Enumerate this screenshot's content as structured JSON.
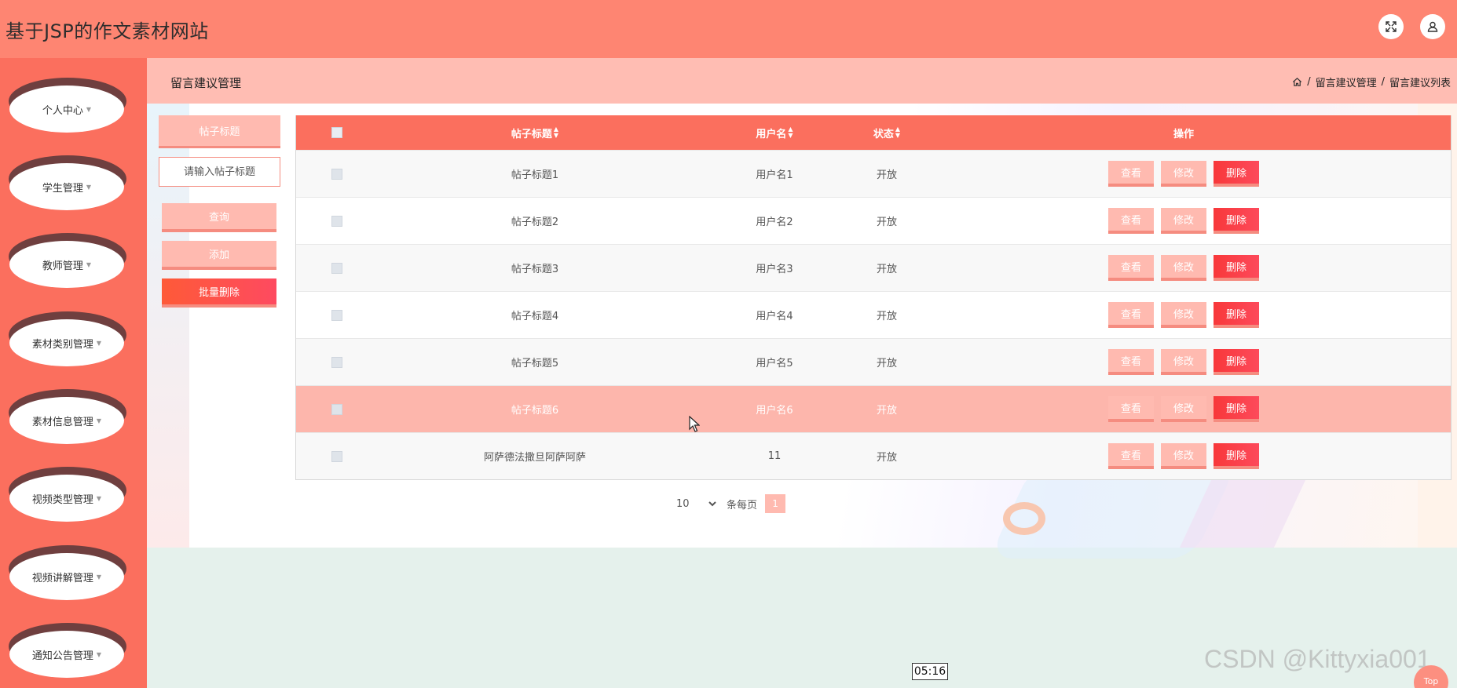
{
  "header": {
    "site_title": "基于JSP的作文素材网站",
    "fullscreen_icon": "expand-icon",
    "user_icon": "user-icon"
  },
  "sidebar": {
    "items": [
      {
        "label": "个人中心"
      },
      {
        "label": "学生管理"
      },
      {
        "label": "教师管理"
      },
      {
        "label": "素材类别管理"
      },
      {
        "label": "素材信息管理"
      },
      {
        "label": "视频类型管理"
      },
      {
        "label": "视频讲解管理"
      },
      {
        "label": "通知公告管理"
      }
    ]
  },
  "page": {
    "title": "留言建议管理",
    "breadcrumb": [
      "留言建议管理",
      "留言建议列表"
    ]
  },
  "search": {
    "label": "帖子标题",
    "placeholder": "请输入帖子标题",
    "query_button": "查询",
    "add_button": "添加",
    "batch_delete_button": "批量删除"
  },
  "table": {
    "columns": [
      "帖子标题",
      "用户名",
      "状态",
      "操作"
    ],
    "rows": [
      {
        "title": "帖子标题1",
        "user": "用户名1",
        "status": "开放"
      },
      {
        "title": "帖子标题2",
        "user": "用户名2",
        "status": "开放"
      },
      {
        "title": "帖子标题3",
        "user": "用户名3",
        "status": "开放"
      },
      {
        "title": "帖子标题4",
        "user": "用户名4",
        "status": "开放"
      },
      {
        "title": "帖子标题5",
        "user": "用户名5",
        "status": "开放"
      },
      {
        "title": "帖子标题6",
        "user": "用户名6",
        "status": "开放"
      },
      {
        "title": "阿萨德法撒旦阿萨阿萨",
        "user": "11",
        "status": "开放"
      }
    ],
    "actions": {
      "view": "查看",
      "edit": "修改",
      "delete": "删除"
    }
  },
  "pagination": {
    "page_size": "10",
    "per_page_label": "条每页",
    "current_page": "1"
  },
  "overlay": {
    "watermark": "CSDN @Kittyxia001",
    "time_tooltip": "05:16",
    "top_button": "Top"
  },
  "colors": {
    "accent": "#fb6f5e",
    "header": "#fe8572",
    "light_accent": "#ffbab0",
    "danger": "#fb3a3f"
  }
}
